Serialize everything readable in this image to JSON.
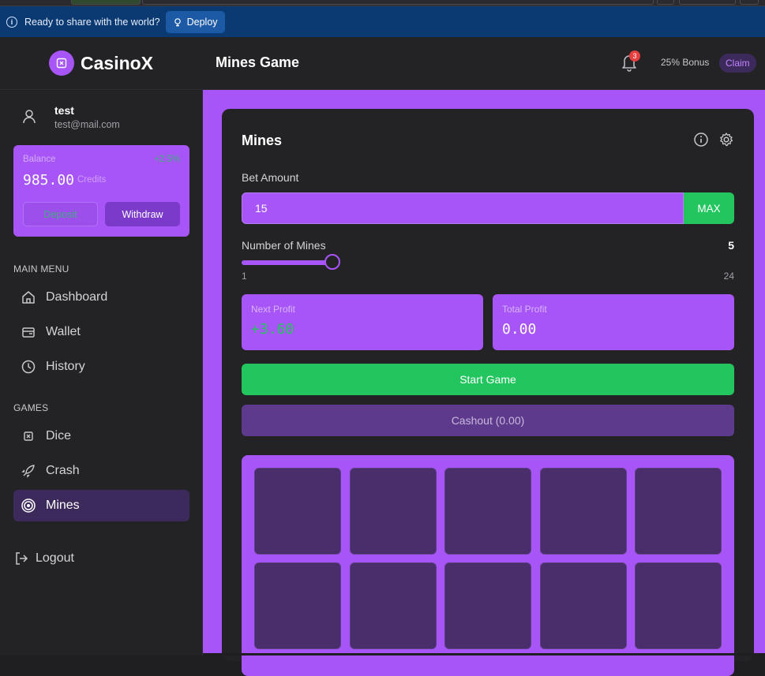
{
  "browser_banner": {
    "message": "Ready to share with the world?",
    "deploy_label": "Deploy"
  },
  "header": {
    "brand": "CasinoX",
    "page_title": "Mines Game",
    "notification_count": "3",
    "bonus_text": "25% Bonus",
    "claim_label": "Claim"
  },
  "user": {
    "name": "test",
    "email": "test@mail.com"
  },
  "balance": {
    "label": "Balance",
    "change": "+2.5%",
    "amount": "985.00",
    "unit": "Credits",
    "deposit_label": "Deposit",
    "withdraw_label": "Withdraw"
  },
  "sidebar": {
    "main_menu_label": "MAIN MENU",
    "main_items": [
      {
        "label": "Dashboard",
        "icon": "home-icon"
      },
      {
        "label": "Wallet",
        "icon": "wallet-icon"
      },
      {
        "label": "History",
        "icon": "clock-icon"
      }
    ],
    "games_label": "GAMES",
    "game_items": [
      {
        "label": "Dice",
        "icon": "dice-icon"
      },
      {
        "label": "Crash",
        "icon": "rocket-icon"
      },
      {
        "label": "Mines",
        "icon": "target-icon",
        "active": true
      }
    ],
    "logout_label": "Logout"
  },
  "game": {
    "title": "Mines",
    "bet_label": "Bet Amount",
    "bet_value": "15",
    "max_label": "MAX",
    "mines_label": "Number of Mines",
    "mines_value": "5",
    "mines_min": "1",
    "mines_max": "24",
    "next_profit_label": "Next Profit",
    "next_profit_value": "+3.60",
    "total_profit_label": "Total Profit",
    "total_profit_value": "0.00",
    "start_label": "Start Game",
    "cashout_label": "Cashout (0.00)"
  },
  "colors": {
    "accent": "#a855f7",
    "success": "#22c55e",
    "tile": "#4a2d6b",
    "panel": "#232326"
  }
}
